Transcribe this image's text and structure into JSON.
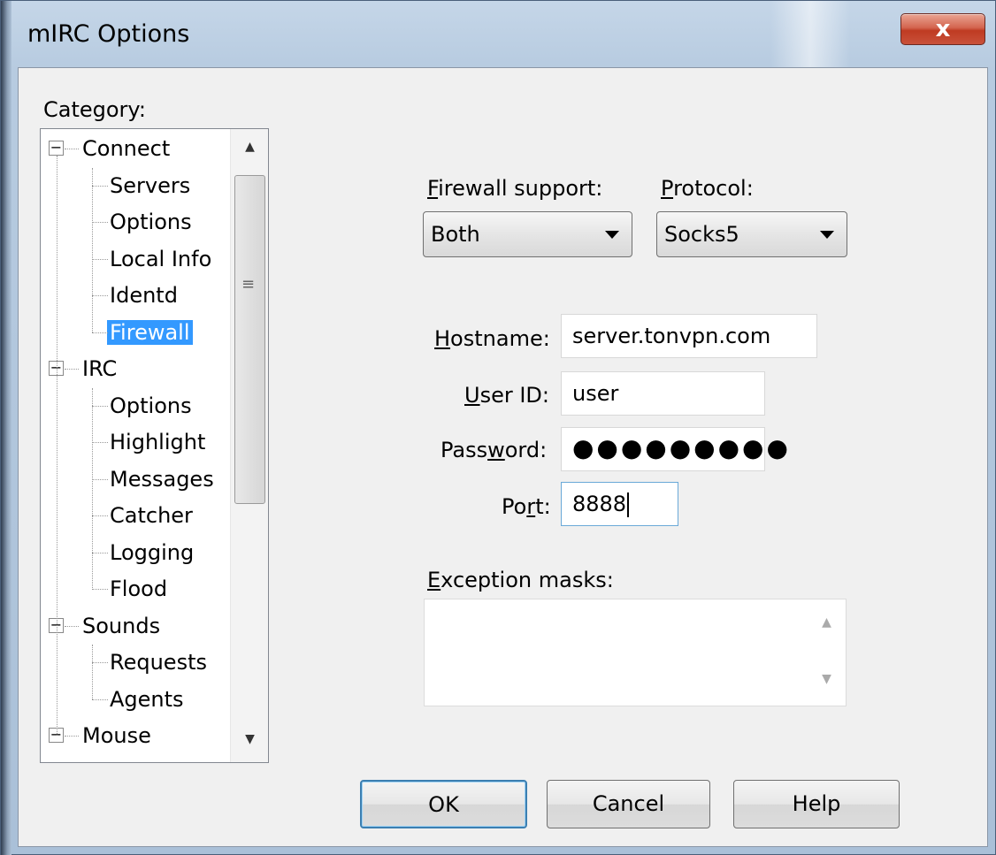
{
  "window": {
    "title": "mIRC Options",
    "close_label": "x"
  },
  "category": {
    "label": "Category:",
    "tree": [
      {
        "label": "Connect",
        "level": 0,
        "expander": "−"
      },
      {
        "label": "Servers",
        "level": 1
      },
      {
        "label": "Options",
        "level": 1
      },
      {
        "label": "Local Info",
        "level": 1
      },
      {
        "label": "Identd",
        "level": 1
      },
      {
        "label": "Firewall",
        "level": 1,
        "selected": true
      },
      {
        "label": "IRC",
        "level": 0,
        "expander": "−"
      },
      {
        "label": "Options",
        "level": 1
      },
      {
        "label": "Highlight",
        "level": 1
      },
      {
        "label": "Messages",
        "level": 1
      },
      {
        "label": "Catcher",
        "level": 1
      },
      {
        "label": "Logging",
        "level": 1
      },
      {
        "label": "Flood",
        "level": 1
      },
      {
        "label": "Sounds",
        "level": 0,
        "expander": "−"
      },
      {
        "label": "Requests",
        "level": 1
      },
      {
        "label": "Agents",
        "level": 1
      },
      {
        "label": "Mouse",
        "level": 0,
        "expander": "−"
      }
    ],
    "scroll_up": "▲",
    "scroll_down": "▼"
  },
  "firewall": {
    "support_label": "Firewall support:",
    "support_mnemonic": "F",
    "support_rest": "irewall support:",
    "support_value": "Both",
    "protocol_label": "Protocol:",
    "protocol_mnemonic": "P",
    "protocol_rest": "rotocol:",
    "protocol_value": "Socks5",
    "hostname_label": "Hostname:",
    "hostname_mnemonic": "H",
    "hostname_rest": "ostname:",
    "hostname_value": "server.tonvpn.com",
    "userid_label": "User ID:",
    "userid_mnemonic": "U",
    "userid_rest": "ser ID:",
    "userid_value": "user",
    "password_label": "Password:",
    "password_pre": "Pass",
    "password_mnemonic": "w",
    "password_rest": "ord:",
    "password_value": "●●●●●●●●●",
    "port_label": "Port:",
    "port_pre": "Po",
    "port_mnemonic": "r",
    "port_rest": "t:",
    "port_value": "8888",
    "exceptions_label": "Exception masks:",
    "exceptions_mnemonic": "E",
    "exceptions_rest": "xception masks:",
    "exceptions_value": ""
  },
  "buttons": {
    "ok": "OK",
    "cancel": "Cancel",
    "help": "Help"
  }
}
